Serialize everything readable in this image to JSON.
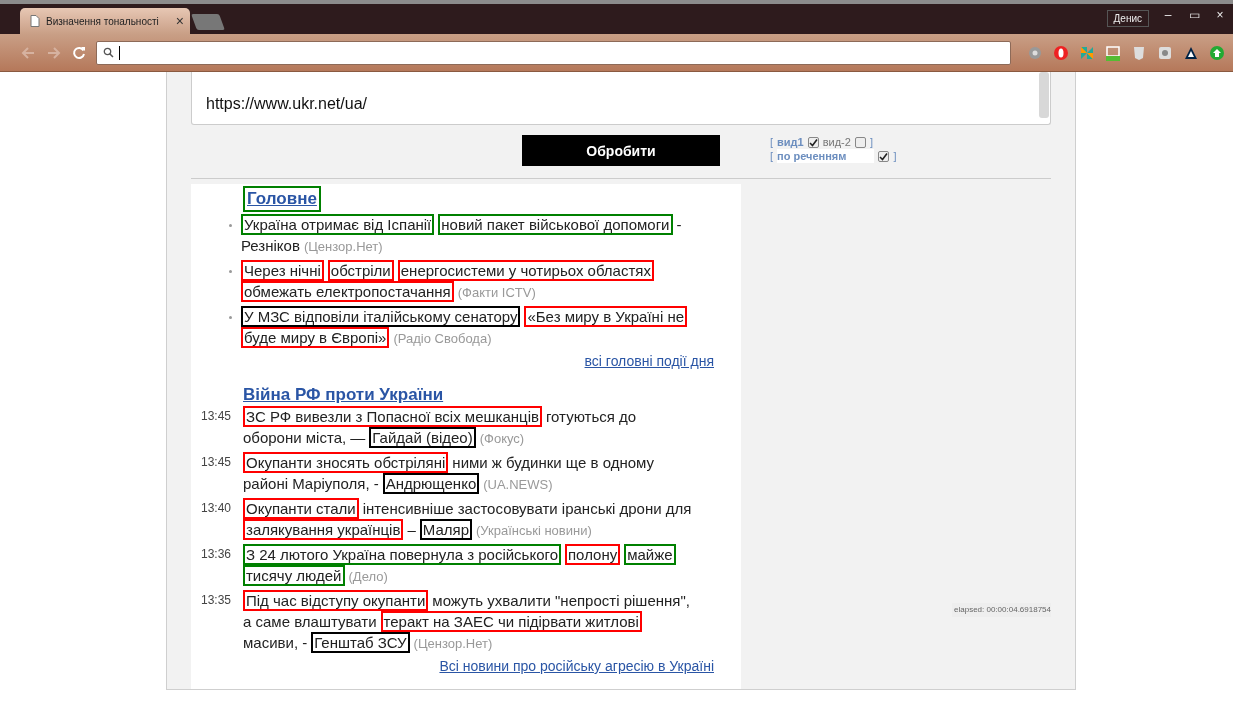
{
  "browser": {
    "tab_title": "Визначення тональності",
    "tab_close": "×",
    "user": "Денис",
    "window_buttons": [
      "–",
      "▭",
      "×"
    ]
  },
  "form": {
    "url": "https://www.ukr.net/ua/",
    "submit": "Обробити",
    "option_rows": [
      {
        "open": "[",
        "items": [
          {
            "label": "вид1",
            "checked": true
          },
          {
            "label": "вид-2",
            "checked": false
          }
        ],
        "close": "]"
      },
      {
        "open": "[",
        "items": [
          {
            "label": "по реченням",
            "checked": true
          }
        ],
        "close": "]"
      }
    ]
  },
  "sections": [
    {
      "title": "Головне",
      "color": "#008000",
      "kind": "bullets",
      "items": [
        {
          "lines": [
            [
              {
                "text": "Україна отримає від Іспанії",
                "color": "#008000"
              },
              {
                "text": "новий пакет військової допомоги",
                "color": "#008000"
              },
              {
                "text": "-"
              }
            ],
            [
              {
                "text": "Резніков"
              }
            ]
          ],
          "source": "(Цензор.Нет)"
        },
        {
          "lines": [
            [
              {
                "text": "Через нічні",
                "color": "#ff0000"
              },
              {
                "text": "обстріли",
                "color": "#ff0000"
              },
              {
                "text": "енергосистеми у чотирьох областях",
                "color": "#ff0000"
              }
            ],
            [
              {
                "text": "обмежать електропостачання",
                "color": "#ff0000"
              }
            ]
          ],
          "source": "(Факти ICTV)"
        },
        {
          "lines": [
            [
              {
                "text": "У МЗС відповіли італійському сенатору",
                "color": "#000000"
              },
              {
                "text": "«Без миру в Україні не",
                "color": "#ff0000"
              }
            ],
            [
              {
                "text": "буде миру в Європі»",
                "color": "#ff0000"
              }
            ]
          ],
          "source": "(Радіо Свобода)"
        }
      ],
      "more": "всі головні події дня"
    },
    {
      "title": "Війна РФ проти України",
      "kind": "timed",
      "items": [
        {
          "time": "13:45",
          "lines": [
            [
              {
                "text": "ЗС РФ вивезли з Попасної всіх мешканців",
                "color": "#ff0000"
              },
              {
                "text": "готуються до"
              }
            ],
            [
              {
                "text": "оборони міста, —"
              },
              {
                "text": "Гайдай (відео)",
                "color": "#000000"
              }
            ]
          ],
          "source": "(Фокус)"
        },
        {
          "time": "13:45",
          "lines": [
            [
              {
                "text": "Окупанти зносять обстріляні",
                "color": "#ff0000"
              },
              {
                "text": "ними ж будинки ще в одному"
              }
            ],
            [
              {
                "text": "районі Маріуполя, -"
              },
              {
                "text": "Андрющенко",
                "color": "#000000"
              }
            ]
          ],
          "source": "(UA.NEWS)"
        },
        {
          "time": "13:40",
          "lines": [
            [
              {
                "text": "Окупанти стали",
                "color": "#ff0000"
              },
              {
                "text": "інтенсивніше застосовувати іранські дрони для"
              }
            ],
            [
              {
                "text": "залякування українців",
                "color": "#ff0000"
              },
              {
                "text": "–"
              },
              {
                "text": "Маляр",
                "color": "#000000"
              }
            ]
          ],
          "source": "(Українські новини)"
        },
        {
          "time": "13:36",
          "lines": [
            [
              {
                "text": "З 24 лютого Україна повернула з російського",
                "color": "#008000"
              },
              {
                "text": "полону",
                "color": "#ff0000"
              },
              {
                "text": "майже",
                "color": "#008000"
              }
            ],
            [
              {
                "text": "тисячу людей",
                "color": "#008000"
              }
            ]
          ],
          "source": "(Дело)"
        },
        {
          "time": "13:35",
          "lines": [
            [
              {
                "text": "Під час відступу окупанти",
                "color": "#ff0000"
              },
              {
                "text": "можуть ухвалити \"непрості рішення\","
              }
            ],
            [
              {
                "text": "а саме влаштувати"
              },
              {
                "text": "теракт на ЗАЕС чи підірвати житлові",
                "color": "#ff0000"
              }
            ],
            [
              {
                "text": "масиви, -"
              },
              {
                "text": "Генштаб ЗСУ",
                "color": "#000000"
              }
            ]
          ],
          "source": "(Цензор.Нет)"
        }
      ],
      "more": "Всі новини про російську агресію в Україні"
    }
  ],
  "elapsed": "elapsed: 00:00:04.6918754"
}
